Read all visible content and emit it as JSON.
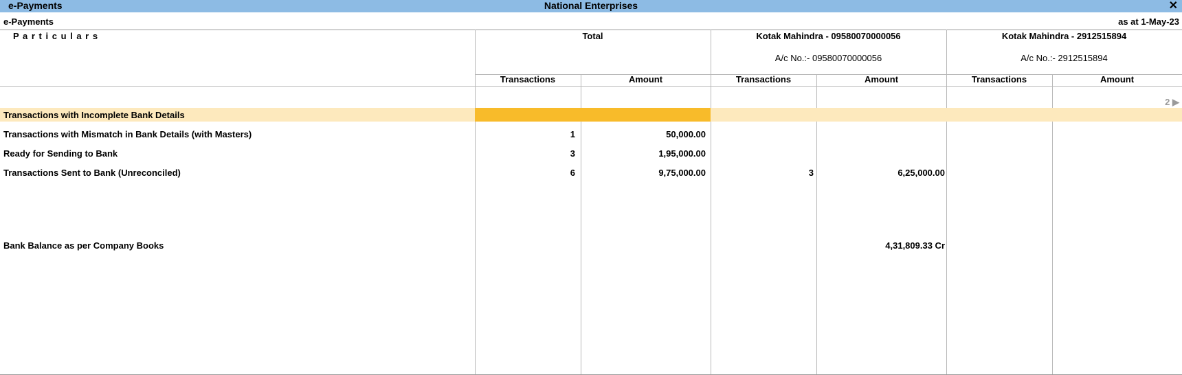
{
  "window": {
    "app_title": "e-Payments",
    "company": "National Enterprises",
    "close_glyph": "✕"
  },
  "report": {
    "name": "e-Payments",
    "as_at": "as at 1-May-23",
    "particulars_label": "P a r t i c u l a r s",
    "page_indicator": "2 ▶"
  },
  "columns": {
    "total": {
      "title": "Total",
      "sub": ""
    },
    "bank1": {
      "title": "Kotak Mahindra - 09580070000056",
      "sub": "A/c No.:- 09580070000056"
    },
    "bank2": {
      "title": "Kotak Mahindra - 2912515894",
      "sub": "A/c No.:- 2912515894"
    },
    "transactions_label": "Transactions",
    "amount_label": "Amount"
  },
  "rows": [
    {
      "label": "Transactions with Incomplete Bank Details",
      "total_txn": "",
      "total_amt": "",
      "b1_txn": "",
      "b1_amt": "",
      "b2_txn": "",
      "b2_amt": ""
    },
    {
      "label": "Transactions with Mismatch in Bank Details (with Masters)",
      "total_txn": "1",
      "total_amt": "50,000.00",
      "b1_txn": "",
      "b1_amt": "",
      "b2_txn": "",
      "b2_amt": ""
    },
    {
      "label": "Ready for Sending to Bank",
      "total_txn": "3",
      "total_amt": "1,95,000.00",
      "b1_txn": "",
      "b1_amt": "",
      "b2_txn": "",
      "b2_amt": ""
    },
    {
      "label": "Transactions Sent to Bank (Unreconciled)",
      "total_txn": "6",
      "total_amt": "9,75,000.00",
      "b1_txn": "3",
      "b1_amt": "6,25,000.00",
      "b2_txn": "",
      "b2_amt": ""
    }
  ],
  "balance": {
    "label": "Bank Balance as per Company Books",
    "b1_amt": "4,31,809.33 Cr"
  },
  "colors": {
    "titlebar": "#8dbbe4",
    "selected_row": "#fde9bd",
    "selected_cell": "#f8bb2a"
  }
}
